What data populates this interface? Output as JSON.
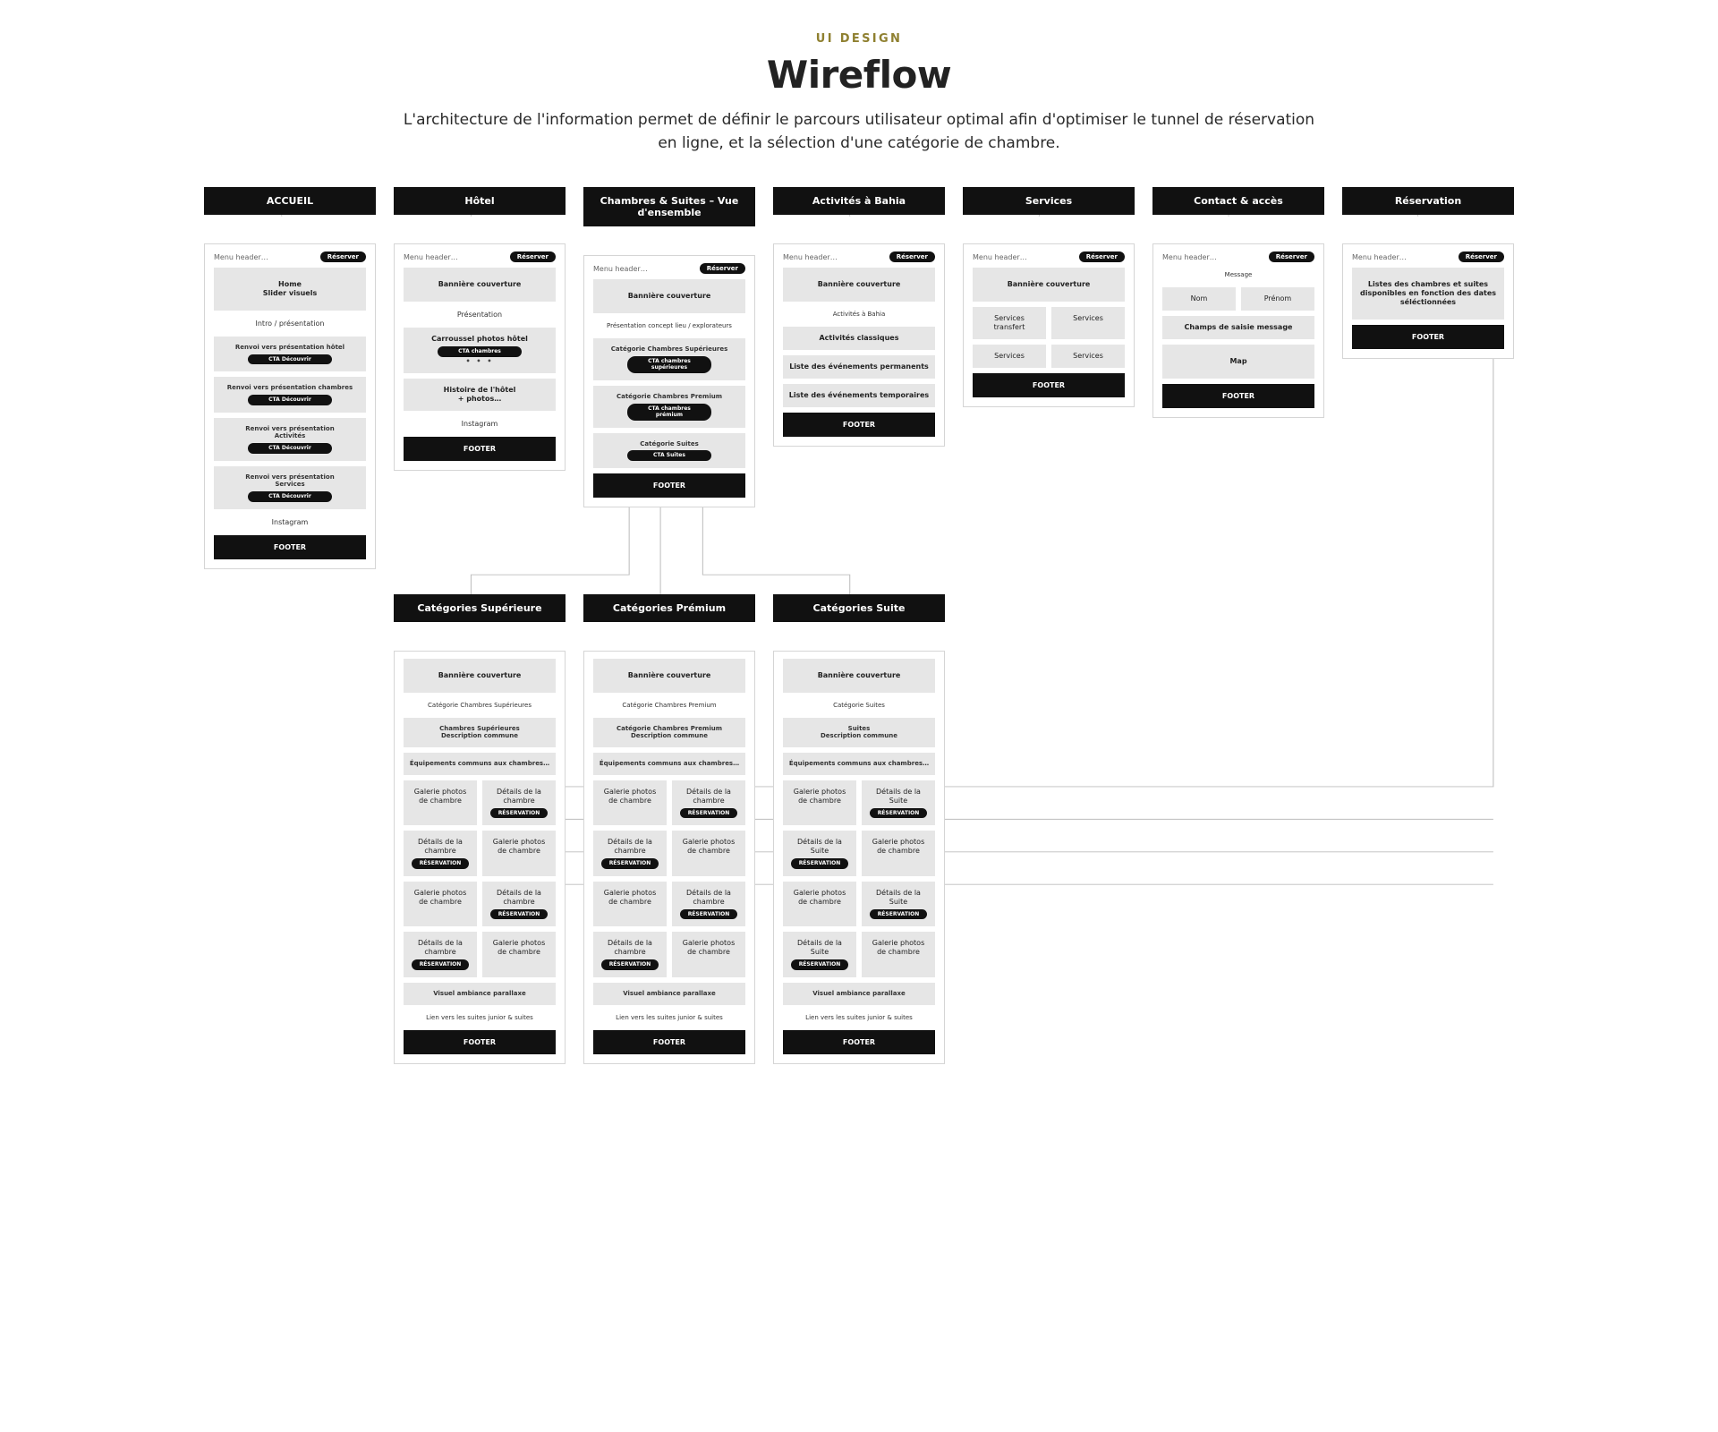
{
  "eyebrow": "UI DESIGN",
  "title": "Wireflow",
  "lede": "L'architecture de l'information permet de définir le parcours utilisateur optimal afin d'optimiser le tunnel de réservation en ligne, et la sélection d'une catégorie de chambre.",
  "common": {
    "menu": "Menu header…",
    "reserve": "Réserver",
    "footer": "FOOTER",
    "banner": "Bannière couverture"
  },
  "top": {
    "accueil": {
      "label": "ACCUEIL",
      "home": "Home\nSlider visuels",
      "intro": "Intro / présentation",
      "p1": {
        "t": "Renvoi vers présentation hôtel",
        "cta": "CTA Découvrir"
      },
      "p2": {
        "t": "Renvoi vers présentation chambres",
        "cta": "CTA Découvrir"
      },
      "p3": {
        "t": "Renvoi vers présentation\nActivités",
        "cta": "CTA Découvrir"
      },
      "p4": {
        "t": "Renvoi vers présentation\nServices",
        "cta": "CTA Découvrir"
      },
      "insta": "Instagram"
    },
    "hotel": {
      "label": "Hôtel",
      "pres": "Présentation",
      "carousel": "Carroussel photos hôtel",
      "carousel_cta": "CTA chambres",
      "history": "Histoire de l'hôtel\n+ photos…",
      "insta": "Instagram"
    },
    "chambres": {
      "label": "Chambres & Suites – Vue d'ensemble",
      "concept": "Présentation concept lieu / explorateurs",
      "sup": {
        "cat": "Catégorie Chambres Supérieures",
        "cta": "CTA chambres supérieures"
      },
      "prem": {
        "cat": "Catégorie Chambres Premium",
        "cta": "CTA chambres prémium"
      },
      "suite": {
        "cat": "Catégorie Suites",
        "cta": "CTA Suites"
      }
    },
    "activites": {
      "label": "Activités à Bahia",
      "intro": "Activités à Bahia",
      "classic": "Activités classiques",
      "perm": "Liste des événements permanents",
      "temp": "Liste des événements temporaires"
    },
    "services": {
      "label": "Services",
      "transfert": "Services transfert",
      "svc": "Services"
    },
    "contact": {
      "label": "Contact & accès",
      "msg": "Message",
      "nom": "Nom",
      "prenom": "Prénom",
      "txt": "Champs de saisie message",
      "map": "Map"
    },
    "resa": {
      "label": "Réservation",
      "list": "Listes des chambres et suites disponibles en fonction des dates séléctionnées"
    }
  },
  "row2": {
    "sup": {
      "label": "Catégories Supérieure",
      "cat": "Catégorie Chambres Supérieures",
      "desc": "Chambres Supérieures\nDescription commune"
    },
    "prem": {
      "label": "Catégories Prémium",
      "cat": "Catégorie Chambres Premium",
      "desc": "Catégorie Chambres Premium\nDescription commune"
    },
    "suite": {
      "label": "Catégories Suite",
      "cat": "Catégorie Suites",
      "desc": "Suites\nDescription commune"
    },
    "shared": {
      "equip": "Équipements communs aux chambres…",
      "gallery": "Galerie photos de chambre",
      "detail": "Détails de la chambre",
      "detail_suite": "Détails de la Suite",
      "reserve_cta": "RÉSERVATION",
      "ambiance": "Visuel ambiance parallaxe",
      "link": "Lien vers les suites junior & suites"
    }
  }
}
